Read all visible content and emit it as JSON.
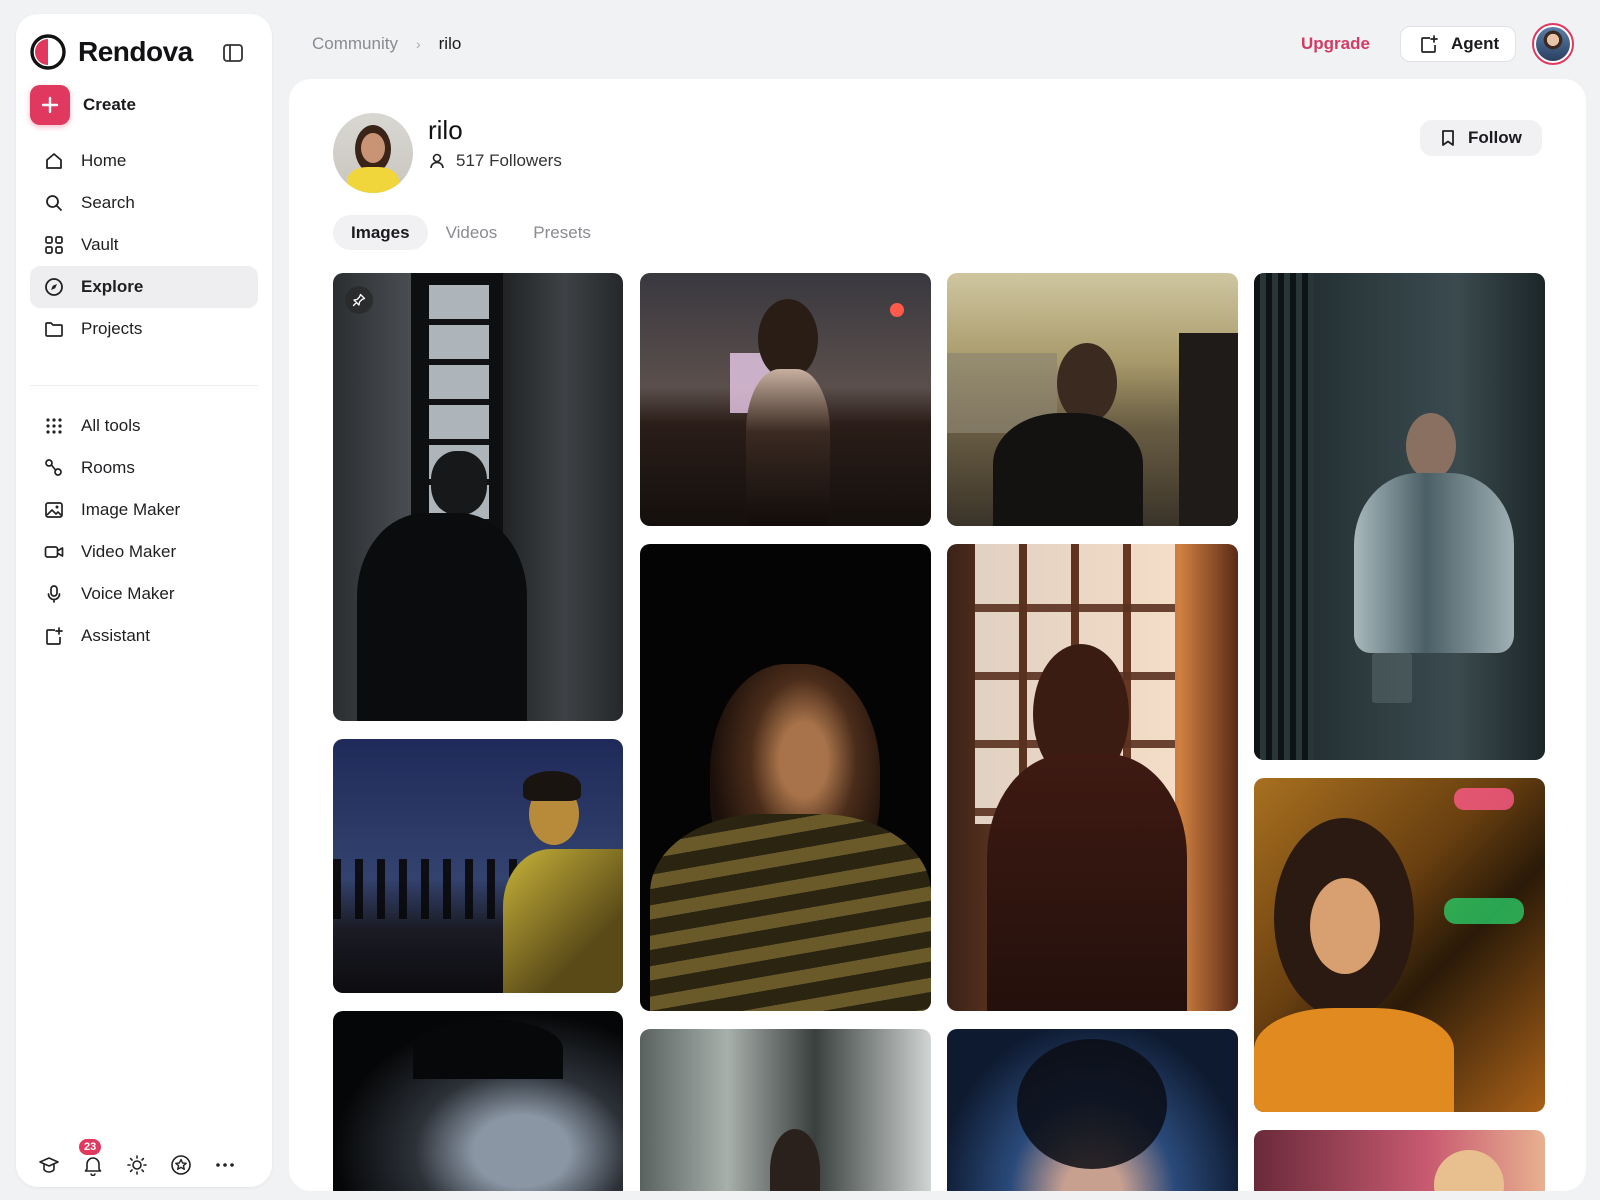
{
  "app": {
    "name": "Rendova"
  },
  "sidebar": {
    "create_label": "Create",
    "primary_items": [
      {
        "label": "Home",
        "icon": "home-icon"
      },
      {
        "label": "Search",
        "icon": "search-icon"
      },
      {
        "label": "Vault",
        "icon": "grid-icon"
      },
      {
        "label": "Explore",
        "icon": "compass-icon",
        "active": true
      },
      {
        "label": "Projects",
        "icon": "folder-icon"
      }
    ],
    "secondary_items": [
      {
        "label": "All tools",
        "icon": "dots-grid-icon"
      },
      {
        "label": "Rooms",
        "icon": "rooms-icon"
      },
      {
        "label": "Image Maker",
        "icon": "image-icon"
      },
      {
        "label": "Video Maker",
        "icon": "video-icon"
      },
      {
        "label": "Voice Maker",
        "icon": "mic-icon"
      },
      {
        "label": "Assistant",
        "icon": "assistant-icon"
      }
    ],
    "notification_count": "23"
  },
  "header": {
    "breadcrumb": [
      "Community",
      "rilo"
    ],
    "upgrade_label": "Upgrade",
    "agent_label": "Agent"
  },
  "profile": {
    "name": "rilo",
    "followers": "517 Followers",
    "follow_label": "Follow"
  },
  "tabs": [
    {
      "label": "Images",
      "active": true
    },
    {
      "label": "Videos",
      "active": false
    },
    {
      "label": "Presets",
      "active": false
    }
  ],
  "colors": {
    "accent": "#e0385e",
    "upgrade": "#d43b63",
    "active_nav_bg": "#eeeef1"
  }
}
